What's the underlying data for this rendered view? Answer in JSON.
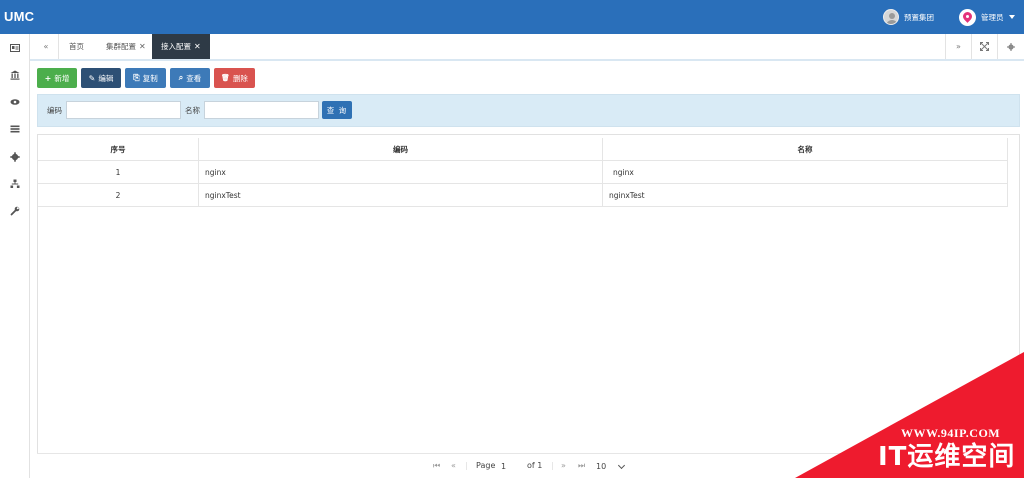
{
  "app": {
    "logo": "UMC",
    "org_name": "预置集团",
    "user_name": "管理员"
  },
  "rail": {
    "icons": [
      "id-card-icon",
      "bank-icon",
      "eye-icon",
      "list-icon",
      "gear-icon",
      "sitemap-icon",
      "wrench-icon"
    ]
  },
  "tabs": {
    "prev_icon": "double-chevron-left-icon",
    "next_icon": "double-chevron-right-icon",
    "fullscreen_icon": "expand-icon",
    "settings_icon": "gear-icon",
    "items": [
      {
        "label": "首页",
        "closable": false
      },
      {
        "label": "集群配置",
        "closable": true,
        "close": "✕"
      },
      {
        "label": "接入配置",
        "closable": true,
        "close": "✕",
        "active": true
      }
    ]
  },
  "toolbar": {
    "add": {
      "label": "新增",
      "icon": "+"
    },
    "edit": {
      "label": "编辑",
      "icon": "✎"
    },
    "copy": {
      "label": "复制",
      "icon": "⎘"
    },
    "view": {
      "label": "查看",
      "icon": "⌕"
    },
    "delete": {
      "label": "删除",
      "icon": "🗑"
    }
  },
  "search": {
    "code_label": "编码",
    "code_value": "",
    "name_label": "名称",
    "name_value": "",
    "button": "查 询"
  },
  "grid": {
    "columns": [
      "序号",
      "编码",
      "名称"
    ],
    "rows": [
      {
        "index": "1",
        "code": "nginx",
        "name": "nginx"
      },
      {
        "index": "2",
        "code": "nginxTest",
        "name": "nginxTest"
      }
    ]
  },
  "pager": {
    "page_label": "Page",
    "page_value": "1",
    "of_label": "of 1",
    "page_size": "10"
  },
  "watermark": {
    "url": "WWW.94IP.COM",
    "name": "IT运维空间"
  },
  "colors": {
    "header": "#2a6fba",
    "active_tab": "#2e3a46",
    "add": "#4cae4c",
    "delete": "#d9534f",
    "search_panel": "#d9ebf6",
    "watermark": "#ee1b2e"
  }
}
